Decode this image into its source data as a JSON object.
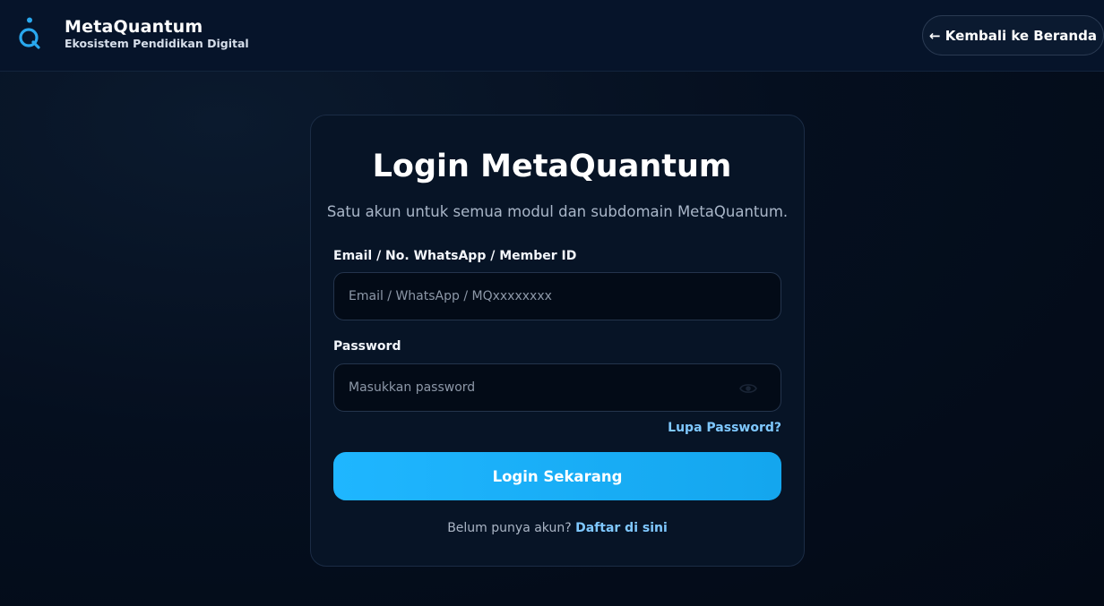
{
  "header": {
    "brand_name": "MetaQuantum",
    "brand_tagline": "Ekosistem Pendidikan Digital",
    "back_button_label": "← Kembali ke Beranda"
  },
  "login": {
    "title": "Login MetaQuantum",
    "subtitle": "Satu akun untuk semua modul dan subdomain MetaQuantum.",
    "identifier_label": "Email / No. WhatsApp / Member ID",
    "identifier_placeholder": "Email / WhatsApp / MQxxxxxxxx",
    "identifier_value": "",
    "password_label": "Password",
    "password_placeholder": "Masukkan password",
    "password_value": "",
    "forgot_label": "Lupa Password?",
    "submit_label": "Login Sekarang",
    "register_prompt": "Belum punya akun?",
    "register_link": "Daftar di sini"
  },
  "icons": {
    "logo": "quantum-logo-icon",
    "toggle_password": "eye-icon"
  },
  "colors": {
    "accent": "#1fb6ff",
    "link": "#7fc8ff",
    "background": "#030c1a",
    "card": "#071426"
  }
}
